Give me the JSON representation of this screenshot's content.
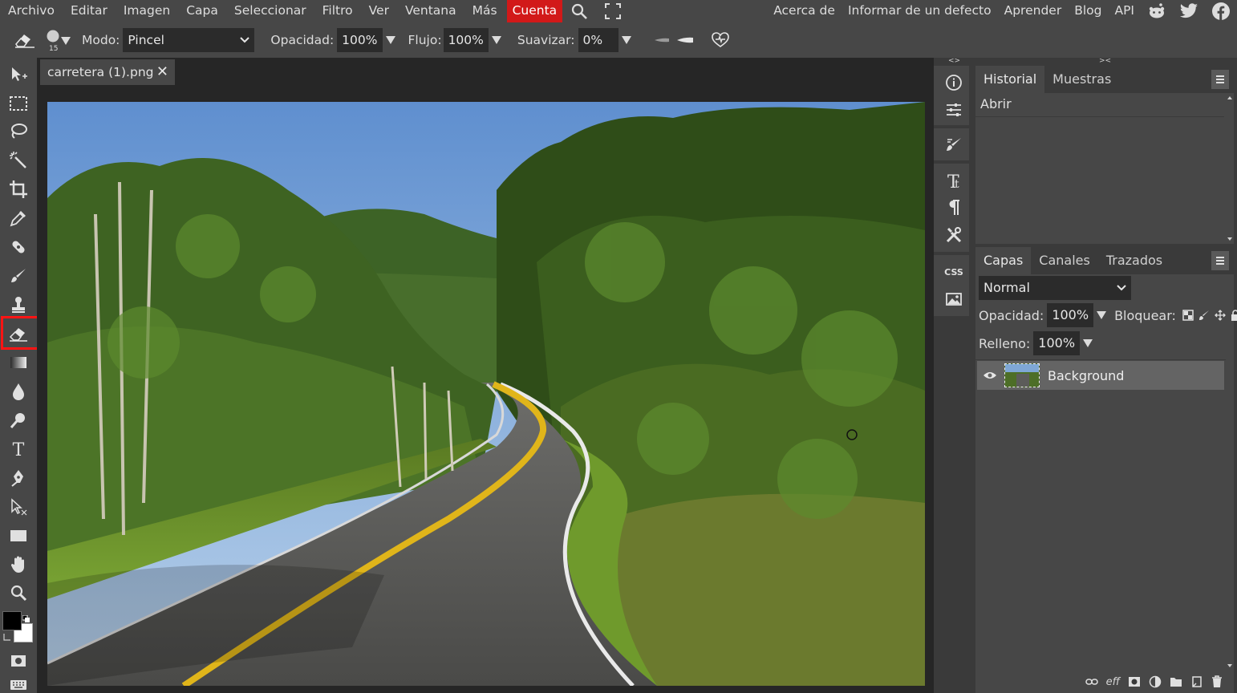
{
  "menu": {
    "items": [
      "Archivo",
      "Editar",
      "Imagen",
      "Capa",
      "Seleccionar",
      "Filtro",
      "Ver",
      "Ventana",
      "Más"
    ],
    "account": "Cuenta",
    "right_links": [
      "Acerca de",
      "Informar de un defecto",
      "Aprender",
      "Blog",
      "API"
    ],
    "accent_color": "#d21919"
  },
  "options": {
    "brush_size": "15",
    "mode_label": "Modo:",
    "mode_value": "Pincel",
    "opacity_label": "Opacidad:",
    "opacity_value": "100%",
    "flow_label": "Flujo:",
    "flow_value": "100%",
    "smooth_label": "Suavizar:",
    "smooth_value": "0%"
  },
  "document": {
    "tab_title": "carretera (1).png",
    "close_glyph": "✕"
  },
  "strip": {
    "css_label": "CSS",
    "expand_left": "<>",
    "expand_right": "><"
  },
  "history_panel": {
    "tabs": [
      "Historial",
      "Muestras"
    ],
    "entries": [
      "Abrir"
    ]
  },
  "layers_panel": {
    "tabs": [
      "Capas",
      "Canales",
      "Trazados"
    ],
    "blend_mode": "Normal",
    "opacity_label": "Opacidad:",
    "opacity_value": "100%",
    "lock_label": "Bloquear:",
    "fill_label": "Relleno:",
    "fill_value": "100%",
    "layers": [
      {
        "name": "Background",
        "visible": true
      }
    ],
    "bottom_icons": [
      "link-icon",
      "eff",
      "mask-icon",
      "adjustment-icon",
      "folder-icon",
      "new-layer-icon",
      "trash-icon"
    ],
    "effects_label": "eff"
  },
  "toolbar": {
    "tools": [
      "move-tool",
      "marquee-tool",
      "lasso-tool",
      "magic-wand-tool",
      "crop-tool",
      "eyedropper-tool",
      "healing-tool",
      "brush-tool",
      "stamp-tool",
      "eraser-tool",
      "gradient-tool",
      "blur-tool",
      "dodge-tool",
      "type-tool",
      "pen-tool",
      "path-select-tool",
      "shape-tool",
      "hand-tool",
      "zoom-tool"
    ],
    "active_tool": "eraser-tool",
    "foreground_color": "#000000",
    "background_color": "#ffffff"
  }
}
